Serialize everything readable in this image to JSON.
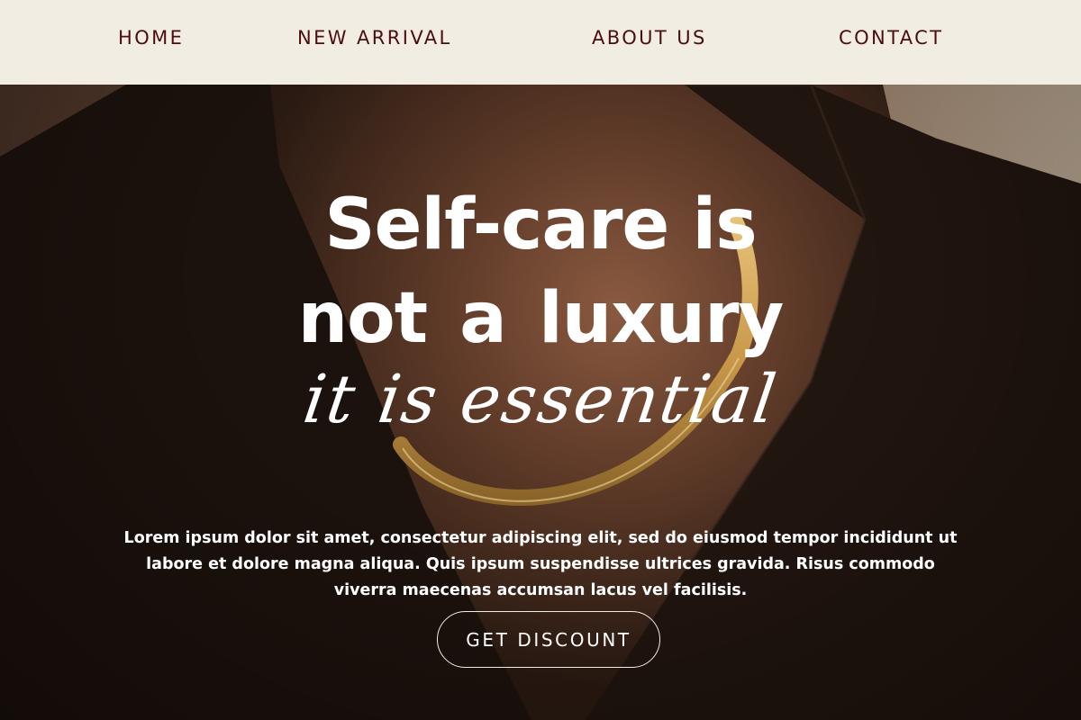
{
  "nav": {
    "items": [
      {
        "label": "HOME"
      },
      {
        "label": "NEW ARRIVAL"
      },
      {
        "label": "ABOUT US"
      },
      {
        "label": "CONTACT"
      }
    ]
  },
  "hero": {
    "headline_line1": "Self-care is",
    "headline_line2": "not  a luxury",
    "script_line": "it is essential",
    "body": "Lorem ipsum dolor sit amet, consectetur adipiscing elit, sed do eiusmod tempor incididunt ut labore et dolore magna aliqua. Quis ipsum suspendisse ultrices gravida. Risus commodo viverra maecenas accumsan lacus vel facilisis.",
    "cta_label": "GET DISCOUNT"
  },
  "colors": {
    "nav_background": "#f2ede3",
    "nav_text": "#4a0e0e",
    "hero_text": "#ffffff",
    "necklace_gold": "#c9994a"
  }
}
